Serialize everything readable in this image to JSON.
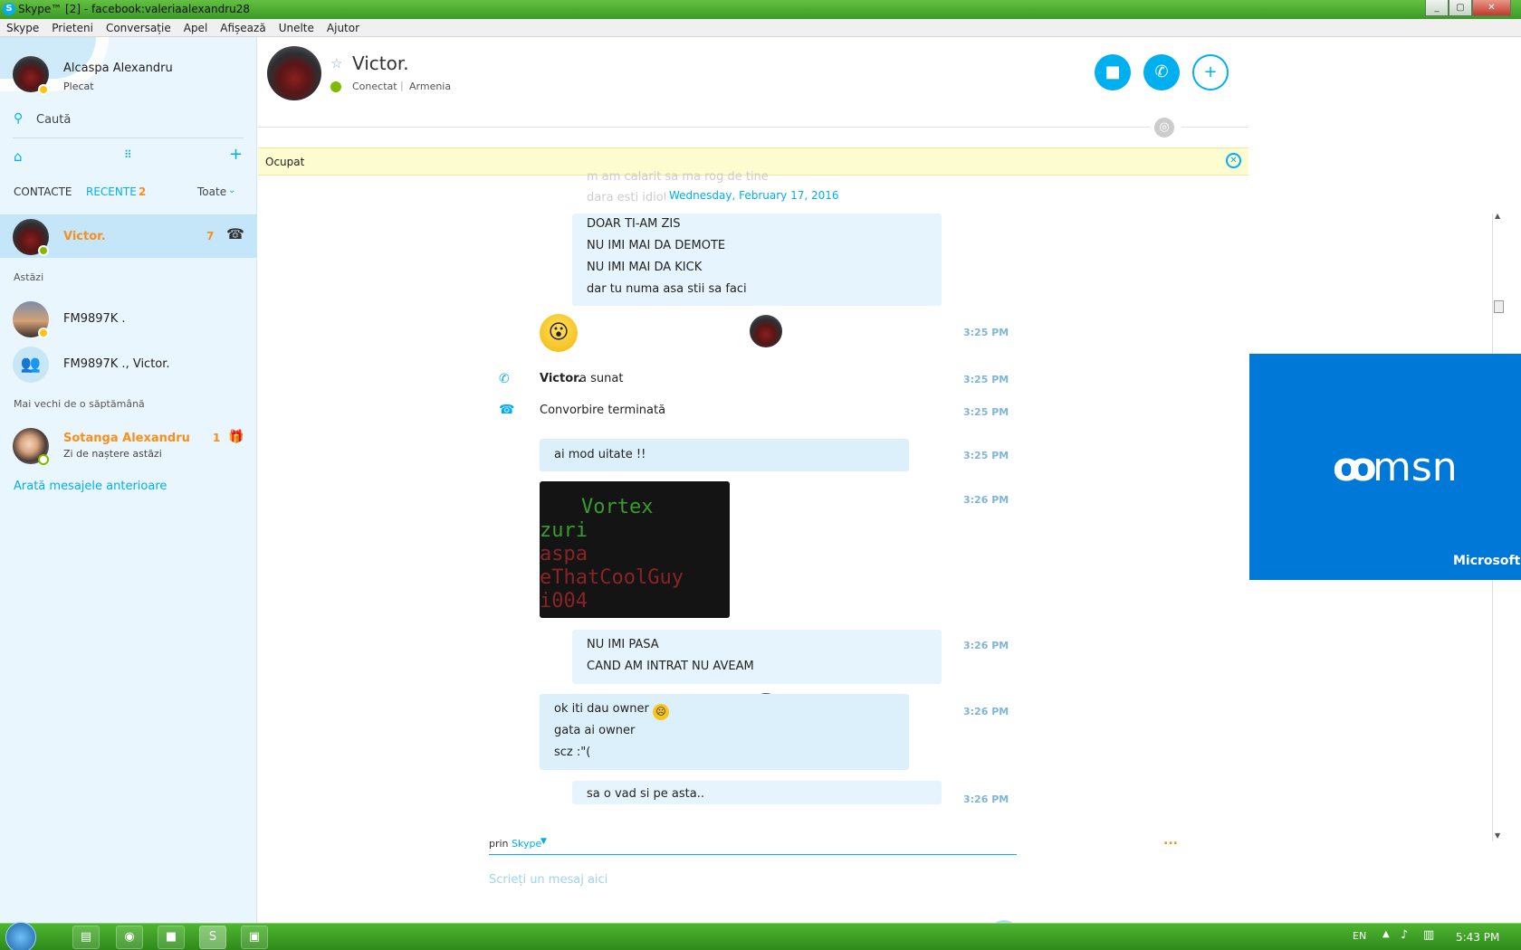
{
  "window": {
    "title": "Skype™ [2] - facebook:valeriaalexandru28",
    "min": "_",
    "max": "▢",
    "close": "✕"
  },
  "menu": [
    "Skype",
    "Prieteni",
    "Conversație",
    "Apel",
    "Afișează",
    "Unelte",
    "Ajutor"
  ],
  "profile": {
    "name": "Alcaspa Alexandru",
    "status": "Plecat"
  },
  "search": {
    "placeholder": "Caută"
  },
  "tabs": {
    "contacts": "CONTACTE",
    "recent": "RECENTE",
    "recent_count": "2",
    "filter": "Toate"
  },
  "recents": {
    "active": {
      "name": "Victor.",
      "count": "7"
    },
    "today_header": "Astăzi",
    "today": [
      {
        "name": "FM9897K ."
      },
      {
        "name": "FM9897K ., Victor."
      }
    ],
    "older_header": "Mai vechi de o săptămână",
    "older": {
      "name": "Sotanga Alexandru",
      "sub": "Zi de naștere astăzi",
      "count": "1"
    },
    "show_more": "Arată mesajele anterioare"
  },
  "chat": {
    "name": "Victor.",
    "status": "Conectat",
    "location": "Armenia",
    "notice": "Ocupat",
    "date": "Wednesday, February 17, 2016",
    "clipped_top": [
      "m am calarit sa ma rog de tine",
      "dara esti idiot asta e clar"
    ],
    "block1": [
      "DOAR TI-AM ZIS",
      "NU IMI MAI DA DEMOTE",
      "NU IMI MAI DA KICK",
      "dar tu numa asa stii sa faci"
    ],
    "t1": "3:25 PM",
    "call_name": "Victor.",
    "call_text": "a sunat",
    "t2": "3:25 PM",
    "call_end": "Convorbire terminată",
    "t3": "3:25 PM",
    "msg_uitate": "ai mod uitate !!",
    "t4": "3:25 PM",
    "image_lines": [
      "Vortex",
      "zuri",
      "aspa",
      "eThatCoolGuy",
      "i004"
    ],
    "t5": "3:26 PM",
    "block2": [
      "NU IMI PASA",
      "CAND AM INTRAT NU AVEAM"
    ],
    "t6": "3:26 PM",
    "block3": [
      "ok iti dau owner",
      "gata ai owner",
      "scz :\"("
    ],
    "t7": "3:26 PM",
    "last": "sa o vad si pe asta..",
    "t8": "3:26 PM",
    "via": "prin",
    "via_service": "Skype",
    "more": "...",
    "input_placeholder": "Scrieți un mesaj aici"
  },
  "ad": {
    "brand": "msn",
    "company": "Microsoft"
  },
  "taskbar": {
    "lang": "EN",
    "clock": "5:43 PM"
  },
  "colors": {
    "accent": "#00aff0",
    "orange": "#f78f1e",
    "notice": "#fdfbd0",
    "msn": "#0078d7"
  }
}
